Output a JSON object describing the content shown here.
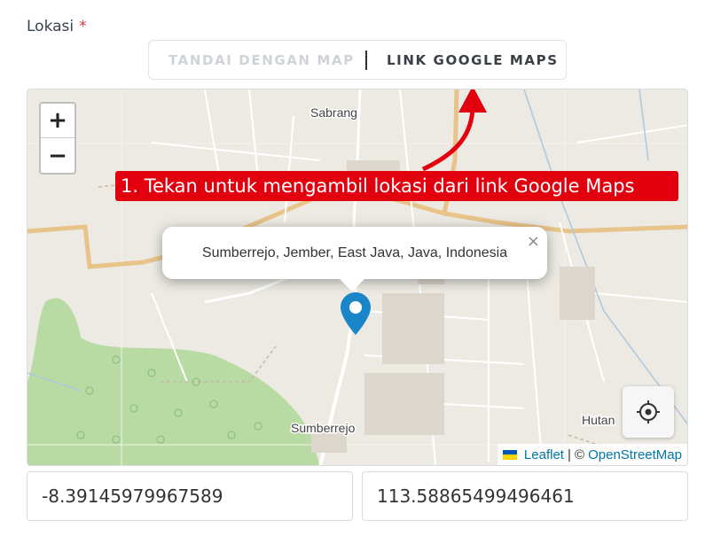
{
  "field": {
    "label": "Lokasi",
    "required_mark": "*"
  },
  "mode_toggle": {
    "options": [
      {
        "label": "TANDAI DENGAN MAP",
        "active": false
      },
      {
        "label": "LINK GOOGLE MAPS",
        "active": true
      }
    ]
  },
  "map": {
    "zoom_in": "+",
    "zoom_out": "−",
    "place_labels": [
      "Sabrang",
      "Sumberrejo",
      "Hutan"
    ],
    "popup": {
      "text": "Sumberrejo, Jember, East Java, Java, Indonesia",
      "close": "×"
    },
    "attribution": {
      "leaflet": "Leaflet",
      "separator": "| ©",
      "osm": "OpenStreetMap"
    },
    "locate_icon": "crosshair-icon",
    "marker_color": "#1a86c9"
  },
  "annotation": {
    "text": "1. Tekan untuk mengambil lokasi dari link Google Maps",
    "color": "#e2000f"
  },
  "coordinates": {
    "latitude": "-8.39145979967589",
    "longitude": "113.58865499496461"
  }
}
